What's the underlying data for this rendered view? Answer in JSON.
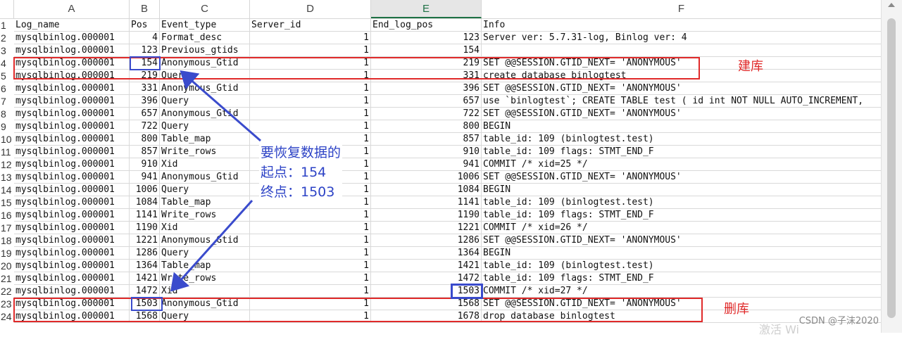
{
  "sheet": {
    "column_headers": [
      "A",
      "B",
      "C",
      "D",
      "E",
      "F"
    ],
    "selected_column": "E",
    "header_row": [
      "Log_name",
      "Pos",
      "Event_type",
      "Server_id",
      "End_log_pos",
      "Info"
    ],
    "rows": [
      [
        "mysqlbinlog.000001",
        "4",
        "Format_desc",
        "1",
        "123",
        "Server ver: 5.7.31-log, Binlog ver: 4"
      ],
      [
        "mysqlbinlog.000001",
        "123",
        "Previous_gtids",
        "1",
        "154",
        ""
      ],
      [
        "mysqlbinlog.000001",
        "154",
        "Anonymous_Gtid",
        "1",
        "219",
        "SET @@SESSION.GTID_NEXT= 'ANONYMOUS'"
      ],
      [
        "mysqlbinlog.000001",
        "219",
        "Query",
        "1",
        "331",
        "create database binlogtest"
      ],
      [
        "mysqlbinlog.000001",
        "331",
        "Anonymous_Gtid",
        "1",
        "396",
        "SET @@SESSION.GTID_NEXT= 'ANONYMOUS'"
      ],
      [
        "mysqlbinlog.000001",
        "396",
        "Query",
        "1",
        "657",
        "use `binlogtest`; CREATE TABLE test (  id int NOT NULL AUTO_INCREMENT,"
      ],
      [
        "mysqlbinlog.000001",
        "657",
        "Anonymous_Gtid",
        "1",
        "722",
        "SET @@SESSION.GTID_NEXT= 'ANONYMOUS'"
      ],
      [
        "mysqlbinlog.000001",
        "722",
        "Query",
        "1",
        "800",
        "BEGIN"
      ],
      [
        "mysqlbinlog.000001",
        "800",
        "Table_map",
        "1",
        "857",
        "table_id: 109 (binlogtest.test)"
      ],
      [
        "mysqlbinlog.000001",
        "857",
        "Write_rows",
        "1",
        "910",
        "table_id: 109 flags: STMT_END_F"
      ],
      [
        "mysqlbinlog.000001",
        "910",
        "Xid",
        "1",
        "941",
        "COMMIT /* xid=25 */"
      ],
      [
        "mysqlbinlog.000001",
        "941",
        "Anonymous_Gtid",
        "1",
        "1006",
        "SET @@SESSION.GTID_NEXT= 'ANONYMOUS'"
      ],
      [
        "mysqlbinlog.000001",
        "1006",
        "Query",
        "1",
        "1084",
        "BEGIN"
      ],
      [
        "mysqlbinlog.000001",
        "1084",
        "Table_map",
        "1",
        "1141",
        "table_id: 109 (binlogtest.test)"
      ],
      [
        "mysqlbinlog.000001",
        "1141",
        "Write_rows",
        "1",
        "1190",
        "table_id: 109 flags: STMT_END_F"
      ],
      [
        "mysqlbinlog.000001",
        "1190",
        "Xid",
        "1",
        "1221",
        "COMMIT /* xid=26 */"
      ],
      [
        "mysqlbinlog.000001",
        "1221",
        "Anonymous_Gtid",
        "1",
        "1286",
        "SET @@SESSION.GTID_NEXT= 'ANONYMOUS'"
      ],
      [
        "mysqlbinlog.000001",
        "1286",
        "Query",
        "1",
        "1364",
        "BEGIN"
      ],
      [
        "mysqlbinlog.000001",
        "1364",
        "Table_map",
        "1",
        "1421",
        "table_id: 109 (binlogtest.test)"
      ],
      [
        "mysqlbinlog.000001",
        "1421",
        "Write_rows",
        "1",
        "1472",
        "table_id: 109 flags: STMT_END_F"
      ],
      [
        "mysqlbinlog.000001",
        "1472",
        "Xid",
        "1",
        "1503",
        "COMMIT /* xid=27 */"
      ],
      [
        "mysqlbinlog.000001",
        "1503",
        "Anonymous_Gtid",
        "1",
        "1568",
        "SET @@SESSION.GTID_NEXT= 'ANONYMOUS'"
      ],
      [
        "mysqlbinlog.000001",
        "1568",
        "Query",
        "1",
        "1678",
        "drop database binlogtest"
      ]
    ]
  },
  "annotations": {
    "create_db_label": "建库",
    "drop_db_label": "删库",
    "note_line1": "要恢复数据的",
    "note_line2": "起点：154",
    "note_line3": "终点：1503"
  },
  "watermark": "CSDN @子沫2020",
  "ghost_text": "激活 Wi",
  "colors": {
    "red_annotation": "#e02a2a",
    "blue_annotation": "#3a4bcc",
    "selected_header_green": "#1e7145"
  }
}
